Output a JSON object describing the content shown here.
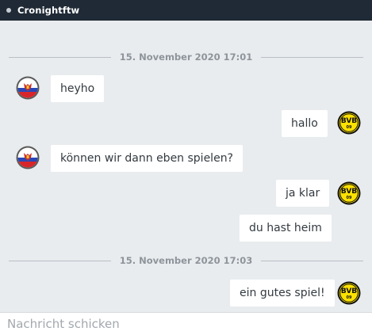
{
  "header": {
    "title": "Cronightftw"
  },
  "conversation": {
    "date_1": "15. November 2020 17:01",
    "date_2": "15. November 2020 17:03",
    "messages": [
      {
        "sender": "other",
        "text": "heyho"
      },
      {
        "sender": "me",
        "text": "hallo"
      },
      {
        "sender": "other",
        "text": "können wir dann eben spielen?"
      },
      {
        "sender": "me",
        "text": "ja klar"
      },
      {
        "sender": "me",
        "text": "du hast heim"
      },
      {
        "sender": "me",
        "text": "ein gutes spiel!"
      }
    ]
  },
  "avatars": {
    "other_icon": "russia-crest-icon",
    "me_icon": "bvb-logo-icon",
    "bvb_text": "BVB",
    "bvb_year": "09"
  },
  "composer": {
    "placeholder": "Nachricht schicken"
  },
  "colors": {
    "header_bg": "#1f2a36",
    "chat_bg": "#e9ecee",
    "bubble_bg": "#ffffff",
    "bvb_yellow": "#fde100"
  }
}
